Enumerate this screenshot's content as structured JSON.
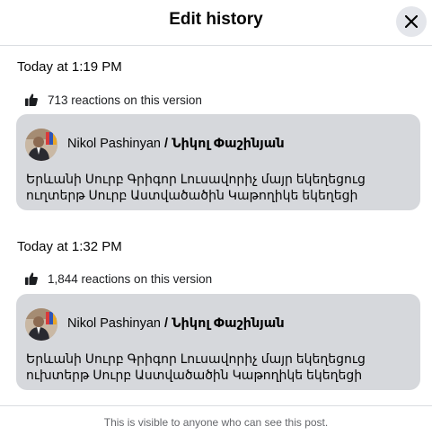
{
  "dialog": {
    "title": "Edit history",
    "close_icon": "close-icon",
    "footer_note": "This is visible to anyone who can see this post."
  },
  "versions": [
    {
      "timestamp": "Today at 1:19 PM",
      "reactions": "713 reactions on this version",
      "author_latin": "Nikol Pashinyan",
      "author_sep": "/",
      "author_armenian": "Նիկոլ Փաշինյան",
      "text": "Երևանի Սուրբ Գրիգոր Լուսավորիչ մայր եկեղեցուց ուղտերթ Սուրբ Աստվածածին Կաթողիկե եկեղեցի"
    },
    {
      "timestamp": "Today at 1:32 PM",
      "reactions": "1,844 reactions on this version",
      "author_latin": "Nikol Pashinyan",
      "author_sep": "/",
      "author_armenian": "Նիկոլ Փաշինյան",
      "text": "Երևանի Սուրբ Գրիգոր Լուսավորիչ մայր եկեղեցուց ուխտերթ Սուրբ Աստվածածին Կաթողիկե եկեղեցի"
    }
  ],
  "colors": {
    "card_bg": "#d6d8dc",
    "close_bg": "#e4e6eb",
    "divider": "#dadde1",
    "secondary_text": "#65676b"
  }
}
